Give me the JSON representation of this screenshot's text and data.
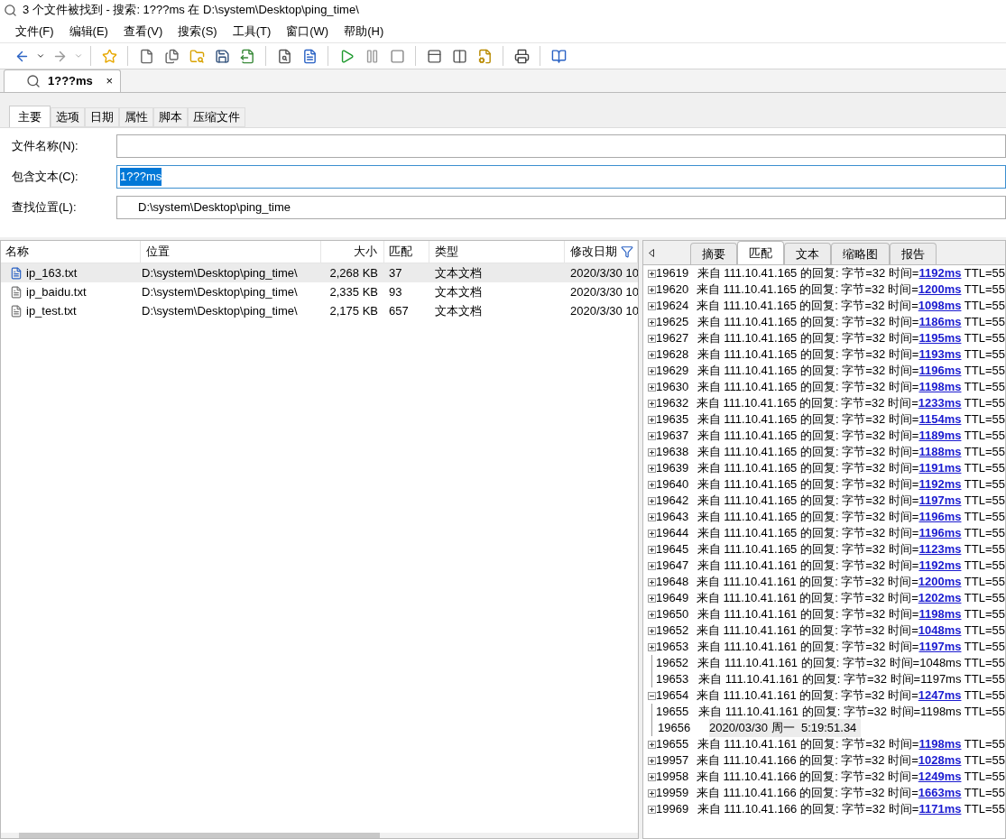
{
  "window": {
    "title": "3 个文件被找到 - 搜索: 1???ms 在 D:\\system\\Desktop\\ping_time\\"
  },
  "menu": [
    "文件(F)",
    "编辑(E)",
    "查看(V)",
    "搜索(S)",
    "工具(T)",
    "窗口(W)",
    "帮助(H)"
  ],
  "doc_tab": {
    "label": "1???ms",
    "close": "×"
  },
  "search_tabs": [
    {
      "label": "主要",
      "selected": true
    },
    {
      "label": "选项",
      "selected": false
    },
    {
      "label": "日期",
      "selected": false
    },
    {
      "label": "属性",
      "selected": false
    },
    {
      "label": "脚本",
      "selected": false
    },
    {
      "label": "压缩文件",
      "selected": false
    }
  ],
  "fields": [
    {
      "label": "文件名称(N):",
      "focused": false
    },
    {
      "label": "包含文本(C):",
      "value": "1???ms",
      "focused": true
    },
    {
      "label": "查找位置(L):",
      "value": "D:\\system\\Desktop\\ping_time",
      "focused": false
    }
  ],
  "results": {
    "columns": [
      "名称",
      "位置",
      "大小",
      "匹配",
      "类型",
      "修改日期"
    ],
    "rows": [
      {
        "name": "ip_163.txt",
        "location": "D:\\system\\Desktop\\ping_time\\",
        "size": "2,268 KB",
        "matches": "37",
        "type": "文本文档",
        "modified": "2020/3/30 10",
        "selected": true
      },
      {
        "name": "ip_baidu.txt",
        "location": "D:\\system\\Desktop\\ping_time\\",
        "size": "2,335 KB",
        "matches": "93",
        "type": "文本文档",
        "modified": "2020/3/30 10",
        "selected": false
      },
      {
        "name": "ip_test.txt",
        "location": "D:\\system\\Desktop\\ping_time\\",
        "size": "2,175 KB",
        "matches": "657",
        "type": "文本文档",
        "modified": "2020/3/30 10",
        "selected": false
      }
    ]
  },
  "preview_tabs": [
    {
      "label": "摘要",
      "selected": false
    },
    {
      "label": "匹配",
      "selected": true
    },
    {
      "label": "文本",
      "selected": false
    },
    {
      "label": "缩略图",
      "selected": false
    },
    {
      "label": "报告",
      "selected": false
    }
  ],
  "matches": [
    {
      "line": "19619",
      "expandable": true,
      "expanded": false,
      "text": "来自 111.10.41.165 的回复: 字节=32 时间=",
      "match": "1192ms",
      "tail": " TTL=55",
      "linked": true
    },
    {
      "line": "19620",
      "expandable": true,
      "expanded": false,
      "text": "来自 111.10.41.165 的回复: 字节=32 时间=",
      "match": "1200ms",
      "tail": " TTL=55",
      "linked": true
    },
    {
      "line": "19624",
      "expandable": true,
      "expanded": false,
      "text": "来自 111.10.41.165 的回复: 字节=32 时间=",
      "match": "1098ms",
      "tail": " TTL=55",
      "linked": true
    },
    {
      "line": "19625",
      "expandable": true,
      "expanded": false,
      "text": "来自 111.10.41.165 的回复: 字节=32 时间=",
      "match": "1186ms",
      "tail": " TTL=55",
      "linked": true
    },
    {
      "line": "19627",
      "expandable": true,
      "expanded": false,
      "text": "来自 111.10.41.165 的回复: 字节=32 时间=",
      "match": "1195ms",
      "tail": " TTL=55",
      "linked": true
    },
    {
      "line": "19628",
      "expandable": true,
      "expanded": false,
      "text": "来自 111.10.41.165 的回复: 字节=32 时间=",
      "match": "1193ms",
      "tail": " TTL=55",
      "linked": true
    },
    {
      "line": "19629",
      "expandable": true,
      "expanded": false,
      "text": "来自 111.10.41.165 的回复: 字节=32 时间=",
      "match": "1196ms",
      "tail": " TTL=55",
      "linked": true
    },
    {
      "line": "19630",
      "expandable": true,
      "expanded": false,
      "text": "来自 111.10.41.165 的回复: 字节=32 时间=",
      "match": "1198ms",
      "tail": " TTL=55",
      "linked": true
    },
    {
      "line": "19632",
      "expandable": true,
      "expanded": false,
      "text": "来自 111.10.41.165 的回复: 字节=32 时间=",
      "match": "1233ms",
      "tail": " TTL=55",
      "linked": true
    },
    {
      "line": "19635",
      "expandable": true,
      "expanded": false,
      "text": "来自 111.10.41.165 的回复: 字节=32 时间=",
      "match": "1154ms",
      "tail": " TTL=55",
      "linked": true
    },
    {
      "line": "19637",
      "expandable": true,
      "expanded": false,
      "text": "来自 111.10.41.165 的回复: 字节=32 时间=",
      "match": "1189ms",
      "tail": " TTL=55",
      "linked": true
    },
    {
      "line": "19638",
      "expandable": true,
      "expanded": false,
      "text": "来自 111.10.41.165 的回复: 字节=32 时间=",
      "match": "1188ms",
      "tail": " TTL=55",
      "linked": true
    },
    {
      "line": "19639",
      "expandable": true,
      "expanded": false,
      "text": "来自 111.10.41.165 的回复: 字节=32 时间=",
      "match": "1191ms",
      "tail": " TTL=55",
      "linked": true
    },
    {
      "line": "19640",
      "expandable": true,
      "expanded": false,
      "text": "来自 111.10.41.165 的回复: 字节=32 时间=",
      "match": "1192ms",
      "tail": " TTL=55",
      "linked": true
    },
    {
      "line": "19642",
      "expandable": true,
      "expanded": false,
      "text": "来自 111.10.41.165 的回复: 字节=32 时间=",
      "match": "1197ms",
      "tail": " TTL=55",
      "linked": true
    },
    {
      "line": "19643",
      "expandable": true,
      "expanded": false,
      "text": "来自 111.10.41.165 的回复: 字节=32 时间=",
      "match": "1196ms",
      "tail": " TTL=55",
      "linked": true
    },
    {
      "line": "19644",
      "expandable": true,
      "expanded": false,
      "text": "来自 111.10.41.165 的回复: 字节=32 时间=",
      "match": "1196ms",
      "tail": " TTL=55",
      "linked": true
    },
    {
      "line": "19645",
      "expandable": true,
      "expanded": false,
      "text": "来自 111.10.41.165 的回复: 字节=32 时间=",
      "match": "1123ms",
      "tail": " TTL=55",
      "linked": true
    },
    {
      "line": "19647",
      "expandable": true,
      "expanded": false,
      "text": "来自 111.10.41.161 的回复: 字节=32 时间=",
      "match": "1192ms",
      "tail": " TTL=55",
      "linked": true
    },
    {
      "line": "19648",
      "expandable": true,
      "expanded": false,
      "text": "来自 111.10.41.161 的回复: 字节=32 时间=",
      "match": "1200ms",
      "tail": " TTL=55",
      "linked": true
    },
    {
      "line": "19649",
      "expandable": true,
      "expanded": false,
      "text": "来自 111.10.41.161 的回复: 字节=32 时间=",
      "match": "1202ms",
      "tail": " TTL=55",
      "linked": true
    },
    {
      "line": "19650",
      "expandable": true,
      "expanded": false,
      "text": "来自 111.10.41.161 的回复: 字节=32 时间=",
      "match": "1198ms",
      "tail": " TTL=55",
      "linked": true
    },
    {
      "line": "19652",
      "expandable": true,
      "expanded": false,
      "text": "来自 111.10.41.161 的回复: 字节=32 时间=",
      "match": "1048ms",
      "tail": " TTL=55",
      "linked": true
    },
    {
      "line": "19653",
      "expandable": true,
      "expanded": false,
      "text": "来自 111.10.41.161 的回复: 字节=32 时间=",
      "match": "1197ms",
      "tail": " TTL=55",
      "linked": true
    },
    {
      "line": "19652",
      "expandable": false,
      "text": "来自 111.10.41.161 的回复: 字节=32 时间=",
      "match": "1048ms",
      "tail": " TTL=55",
      "linked": false
    },
    {
      "line": "19653",
      "expandable": false,
      "text": "来自 111.10.41.161 的回复: 字节=32 时间=",
      "match": "1197ms",
      "tail": " TTL=55",
      "linked": false
    },
    {
      "line": "19654",
      "expandable": true,
      "expanded": true,
      "text": "来自 111.10.41.161 的回复: 字节=32 时间=",
      "match": "1247ms",
      "tail": " TTL=55",
      "linked": true
    },
    {
      "line": "19655",
      "expandable": false,
      "text": "来自 111.10.41.161 的回复: 字节=32 时间=",
      "match": "1198ms",
      "tail": " TTL=55",
      "linked": false
    },
    {
      "line": "19656",
      "expandable": false,
      "text": "2020/03/30 周一  5:19:51.34",
      "highlighted": true
    },
    {
      "line": "19655",
      "expandable": true,
      "expanded": false,
      "text": "来自 111.10.41.161 的回复: 字节=32 时间=",
      "match": "1198ms",
      "tail": " TTL=55",
      "linked": true
    },
    {
      "line": "19957",
      "expandable": true,
      "expanded": false,
      "text": "来自 111.10.41.166 的回复: 字节=32 时间=",
      "match": "1028ms",
      "tail": " TTL=55",
      "linked": true
    },
    {
      "line": "19958",
      "expandable": true,
      "expanded": false,
      "text": "来自 111.10.41.166 的回复: 字节=32 时间=",
      "match": "1249ms",
      "tail": " TTL=55",
      "linked": true
    },
    {
      "line": "19959",
      "expandable": true,
      "expanded": false,
      "text": "来自 111.10.41.166 的回复: 字节=32 时间=",
      "match": "1663ms",
      "tail": " TTL=55",
      "linked": true
    },
    {
      "line": "19969",
      "expandable": true,
      "expanded": false,
      "text": "来自 111.10.41.166 的回复: 字节=32 时间=",
      "match": "1171ms",
      "tail": " TTL=55",
      "linked": true
    }
  ]
}
